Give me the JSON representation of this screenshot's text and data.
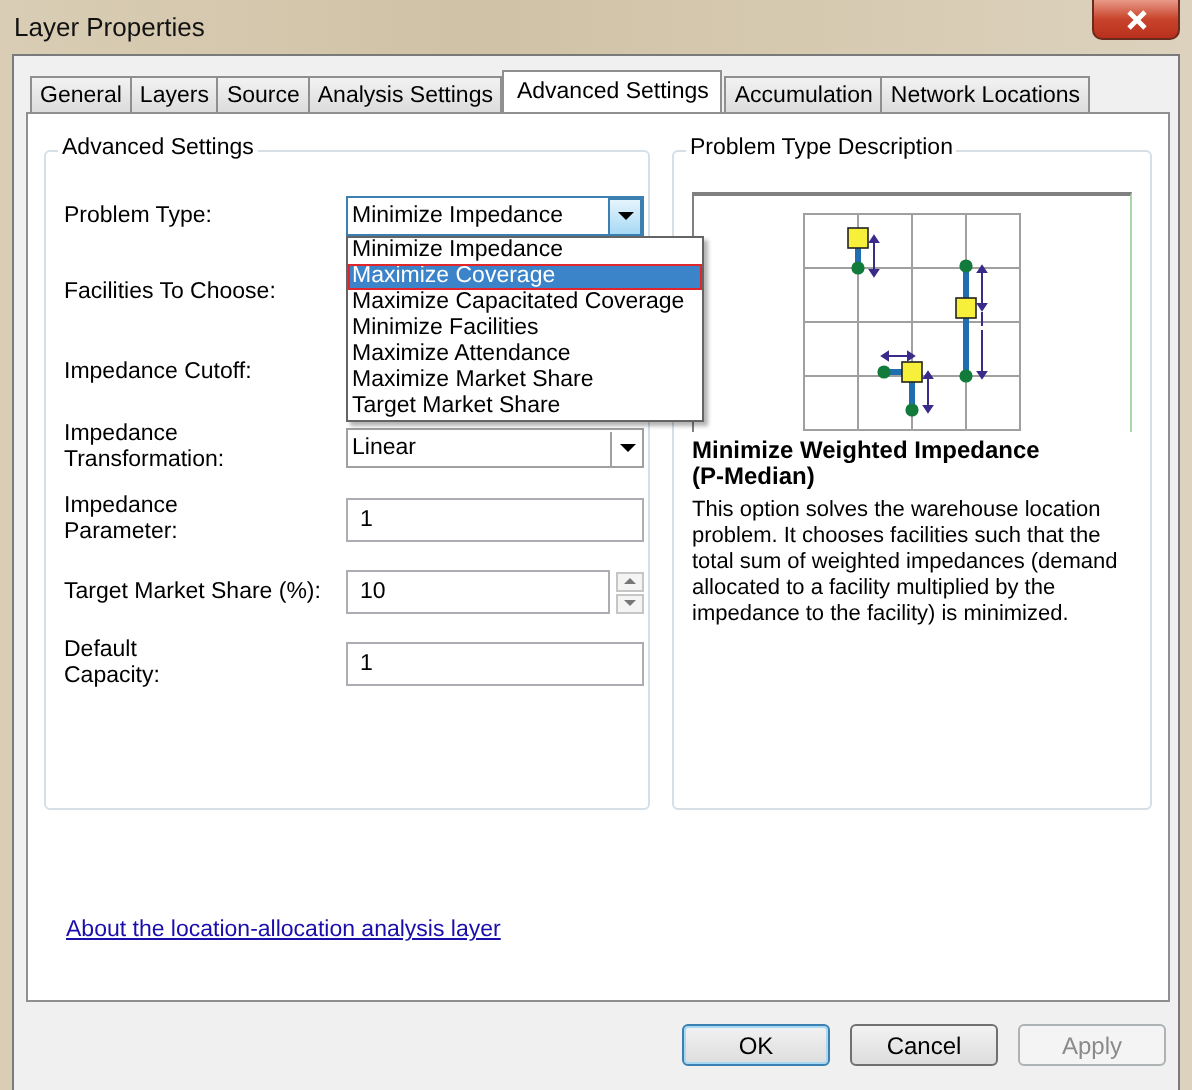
{
  "window": {
    "title": "Layer Properties"
  },
  "tabs": [
    {
      "label": "General",
      "selected": false
    },
    {
      "label": "Layers",
      "selected": false
    },
    {
      "label": "Source",
      "selected": false
    },
    {
      "label": "Analysis Settings",
      "selected": false
    },
    {
      "label": "Advanced Settings",
      "selected": true
    },
    {
      "label": "Accumulation",
      "selected": false
    },
    {
      "label": "Network Locations",
      "selected": false
    }
  ],
  "advanced_settings": {
    "title": "Advanced Settings",
    "fields": [
      {
        "label": "Problem Type:",
        "kind": "dropdown",
        "value": "Minimize Impedance",
        "open": true
      },
      {
        "label": "Facilities To Choose:",
        "kind": "covered"
      },
      {
        "label": "Impedance Cutoff:",
        "kind": "covered"
      },
      {
        "label": "Impedance\nTransformation:",
        "kind": "dropdown",
        "value": "Linear",
        "open": false
      },
      {
        "label": "Impedance\nParameter:",
        "kind": "text",
        "value": "1"
      },
      {
        "label": "Target Market Share (%):",
        "kind": "spinner",
        "value": "10"
      },
      {
        "label": "Default\nCapacity:",
        "kind": "text",
        "value": "1"
      }
    ]
  },
  "dropdown_list": {
    "options": [
      {
        "label": "Minimize Impedance",
        "selected": false
      },
      {
        "label": "Maximize Coverage",
        "selected": true
      },
      {
        "label": "Maximize Capacitated Coverage",
        "selected": false
      },
      {
        "label": "Minimize Facilities",
        "selected": false
      },
      {
        "label": "Maximize Attendance",
        "selected": false
      },
      {
        "label": "Maximize Market Share",
        "selected": false
      },
      {
        "label": "Target Market Share",
        "selected": false
      }
    ]
  },
  "problem_type_description": {
    "title": "Problem Type Description",
    "heading": "Minimize Weighted Impedance (P-Median)",
    "body": "This option solves the warehouse location problem. It chooses facilities such that the total sum of weighted impedances (demand allocated to a facility multiplied by the impedance to the facility) is minimized."
  },
  "link": "About the location-allocation analysis layer",
  "buttons": [
    {
      "label": "OK",
      "default": true,
      "disabled": false
    },
    {
      "label": "Cancel",
      "default": false,
      "disabled": false
    },
    {
      "label": "Apply",
      "default": false,
      "disabled": true
    }
  ]
}
